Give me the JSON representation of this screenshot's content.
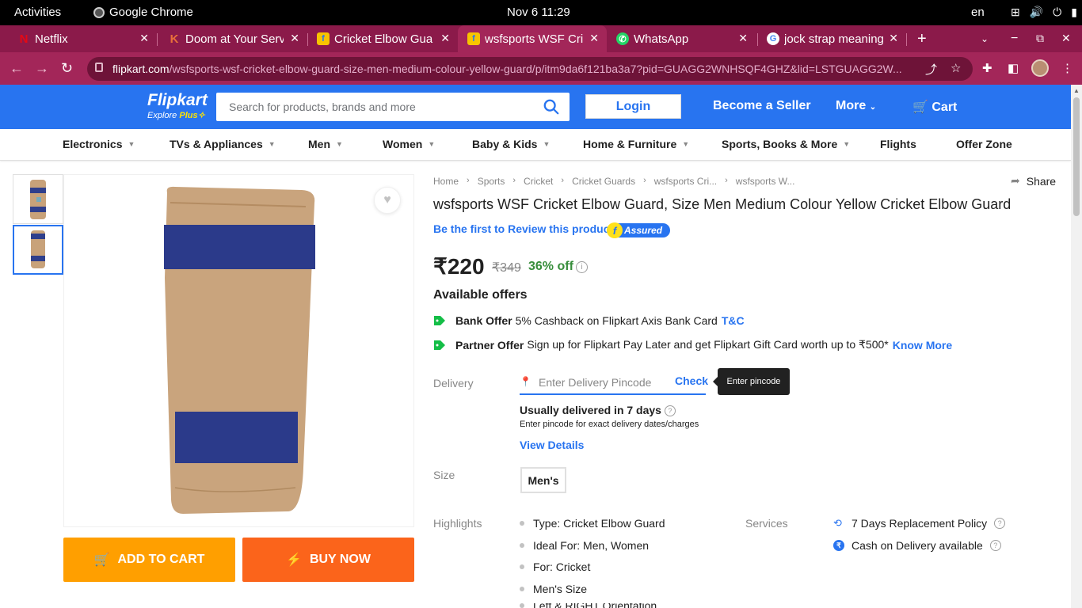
{
  "os": {
    "activities": "Activities",
    "app": "Google Chrome",
    "clock": "Nov 6  11:29",
    "lang": "en"
  },
  "tabs": [
    {
      "title": "Netflix",
      "favicon": "N",
      "color": "#e50914"
    },
    {
      "title": "Doom at Your Serv",
      "favicon": "K",
      "color": "#e8703a"
    },
    {
      "title": "Cricket Elbow Gua",
      "favicon": "f",
      "color": "#f7c400"
    },
    {
      "title": "wsfsports WSF Cri",
      "favicon": "f",
      "color": "#f7c400",
      "active": true
    },
    {
      "title": "WhatsApp",
      "favicon": "w",
      "color": "#25d366"
    },
    {
      "title": "jock strap meaning",
      "favicon": "G",
      "color": "#4285f4"
    }
  ],
  "address": {
    "domain": "flipkart.com",
    "path": "/wsfsports-wsf-cricket-elbow-guard-size-men-medium-colour-yellow-guard/p/itm9da6f121ba3a7?pid=GUAGG2WNHSQF4GHZ&lid=LSTGUAGG2W..."
  },
  "header": {
    "logo": "Flipkart",
    "logo_sub": "Explore",
    "logo_plus": "Plus",
    "search_placeholder": "Search for products, brands and more",
    "login": "Login",
    "seller": "Become a Seller",
    "more": "More",
    "cart": "Cart",
    "brand_color": "#2874f0"
  },
  "categories": [
    "Electronics",
    "TVs & Appliances",
    "Men",
    "Women",
    "Baby & Kids",
    "Home & Furniture",
    "Sports, Books & More",
    "Flights",
    "Offer Zone"
  ],
  "breadcrumbs": [
    "Home",
    "Sports",
    "Cricket",
    "Cricket Guards",
    "wsfsports Cri...",
    "wsfsports W..."
  ],
  "share": "Share",
  "product": {
    "title": "wsfsports WSF Cricket Elbow Guard, Size Men Medium Colour Yellow Cricket Elbow Guard",
    "review": "Be the first to Review this product",
    "assured": "Assured",
    "price": "₹220",
    "mrp": "₹349",
    "discount": "36% off"
  },
  "offers": {
    "heading": "Available offers",
    "items": [
      {
        "type": "Bank Offer",
        "text": "5% Cashback on Flipkart Axis Bank Card",
        "link": "T&C"
      },
      {
        "type": "Partner Offer",
        "text": "Sign up for Flipkart Pay Later and get Flipkart Gift Card worth up to ₹500*",
        "link": "Know More"
      }
    ]
  },
  "delivery": {
    "label": "Delivery",
    "placeholder": "Enter Delivery Pincode",
    "check": "Check",
    "tooltip": "Enter pincode",
    "estimate": "Usually delivered in 7 days",
    "sub": "Enter pincode for exact delivery dates/charges",
    "details": "View Details"
  },
  "size": {
    "label": "Size",
    "value": "Men's"
  },
  "highlights": {
    "label": "Highlights",
    "items": [
      "Type: Cricket Elbow Guard",
      "Ideal For: Men, Women",
      "For: Cricket",
      "Men's Size",
      "Left & RIGHT Orientation"
    ]
  },
  "services": {
    "label": "Services",
    "items": [
      "7 Days Replacement Policy",
      "Cash on Delivery available"
    ]
  },
  "buttons": {
    "add_to_cart": "ADD TO CART",
    "buy_now": "BUY NOW"
  }
}
